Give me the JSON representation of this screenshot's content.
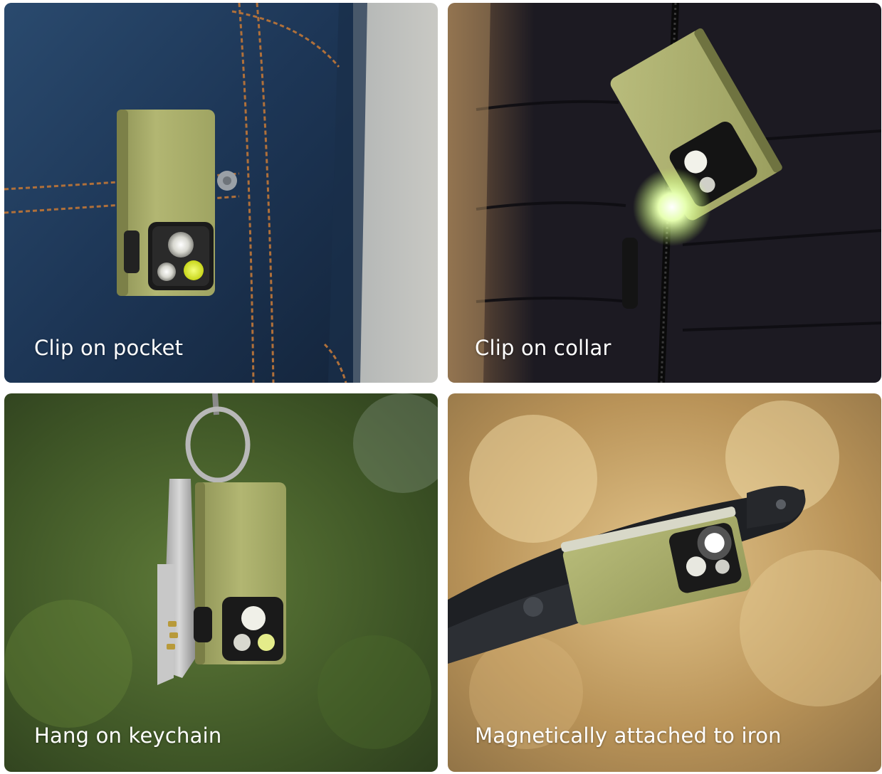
{
  "panels": [
    {
      "caption": "Clip on pocket"
    },
    {
      "caption": "Clip on collar"
    },
    {
      "caption": "Hang on keychain"
    },
    {
      "caption": "Magnetically attached to iron"
    }
  ],
  "colors": {
    "flashlight_body": "#a9ad6a",
    "denim": "#1e3a5c",
    "jacket": "#1c1a22",
    "bokeh_green": "#4f6a2e",
    "bokeh_gold": "#c9a465"
  }
}
